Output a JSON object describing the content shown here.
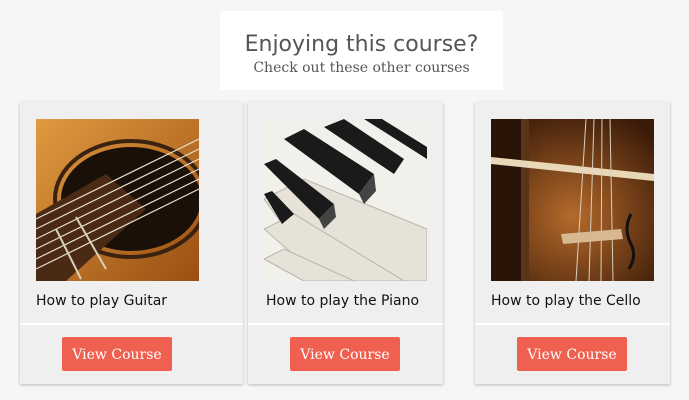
{
  "header": {
    "title": "Enjoying this course?",
    "subtitle": "Check out these other courses"
  },
  "courses": [
    {
      "title": "How to play Guitar",
      "button_label": "View Course",
      "image": "guitar-photo"
    },
    {
      "title": "How to play the Piano",
      "button_label": "View Course",
      "image": "piano-photo"
    },
    {
      "title": "How to play the Cello",
      "button_label": "View Course",
      "image": "cello-photo"
    }
  ],
  "colors": {
    "button": "#f06050",
    "card": "#efefef",
    "page": "#f6f6f6"
  }
}
